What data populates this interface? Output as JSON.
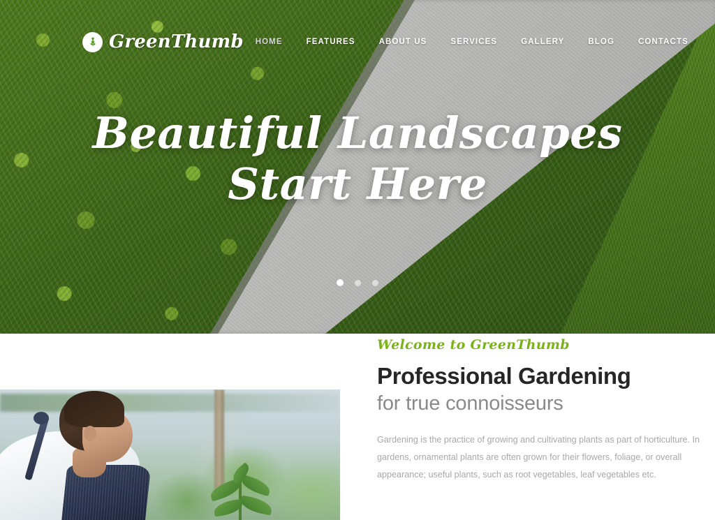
{
  "brand": {
    "name": "GreenThumb",
    "logo_icon": "tulip-flower-icon",
    "accent_green": "#7ab317",
    "logo_color": "#ffffff"
  },
  "nav": {
    "items": [
      {
        "label": "HOME",
        "active": true
      },
      {
        "label": "FEATURES",
        "active": false
      },
      {
        "label": "ABOUT US",
        "active": false
      },
      {
        "label": "SERVICES",
        "active": false
      },
      {
        "label": "GALLERY",
        "active": false
      },
      {
        "label": "BLOG",
        "active": false
      },
      {
        "label": "CONTACTS",
        "active": false
      }
    ]
  },
  "hero": {
    "title_line1": "Beautiful Landscapes",
    "title_line2": "Start Here",
    "slider_dots": [
      {
        "active": true
      },
      {
        "active": false
      },
      {
        "active": false
      }
    ]
  },
  "intro": {
    "photo_alt": "gardener-tending-plant-photo",
    "eyebrow": "Welcome to GreenThumb",
    "heading": "Professional Gardening",
    "subheading": "for true connoisseurs",
    "body": "Gardening is the practice of growing and cultivating plants as part of horticulture. In gardens, ornamental plants are often grown for their flowers, foliage, or overall appearance; useful plants, such as root vegetables, leaf vegetables etc."
  }
}
